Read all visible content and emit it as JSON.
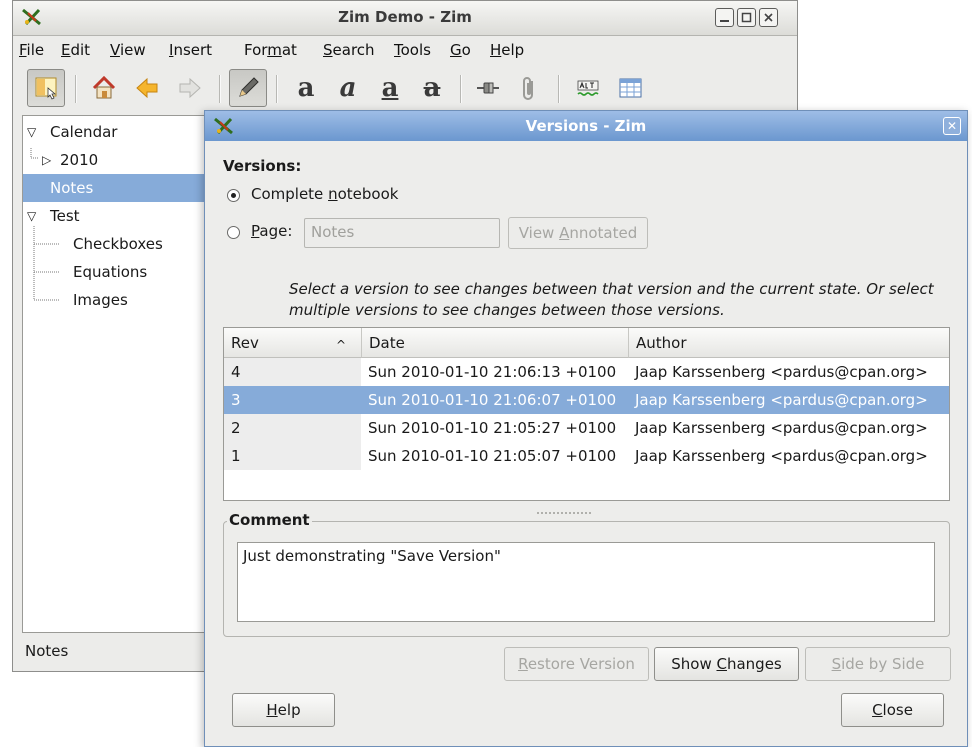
{
  "main_window": {
    "title": "Zim Demo - Zim",
    "menu": [
      {
        "name": "menu-file",
        "pre": "",
        "key": "F",
        "post": "ile"
      },
      {
        "name": "menu-edit",
        "pre": "",
        "key": "E",
        "post": "dit"
      },
      {
        "name": "menu-view",
        "pre": "",
        "key": "V",
        "post": "iew"
      },
      {
        "name": "menu-insert",
        "pre": "",
        "key": "I",
        "post": "nsert"
      },
      {
        "name": "menu-format",
        "pre": "For",
        "key": "m",
        "post": "at"
      },
      {
        "name": "menu-search",
        "pre": "",
        "key": "S",
        "post": "earch"
      },
      {
        "name": "menu-tools",
        "pre": "",
        "key": "T",
        "post": "ools"
      },
      {
        "name": "menu-go",
        "pre": "",
        "key": "G",
        "post": "o"
      },
      {
        "name": "menu-help",
        "pre": "",
        "key": "H",
        "post": "elp"
      }
    ],
    "toolbar_glyphs": {
      "strong": "a",
      "emphasis": "a",
      "mark": "a",
      "strike": "a"
    },
    "index": [
      {
        "label": "Calendar",
        "expander": "open",
        "depth": 0
      },
      {
        "label": "2010",
        "expander": "closed",
        "depth": 1
      },
      {
        "label": "Notes",
        "expander": "none",
        "depth": 0,
        "selected": true
      },
      {
        "label": "Test",
        "expander": "open",
        "depth": 0
      },
      {
        "label": "Checkboxes",
        "expander": "none",
        "depth": 1
      },
      {
        "label": "Equations",
        "expander": "none",
        "depth": 1
      },
      {
        "label": "Images",
        "expander": "none",
        "depth": 1
      }
    ],
    "status_text": "Notes"
  },
  "dialog": {
    "title": "Versions - Zim",
    "versions_heading": "Versions:",
    "complete_notebook": {
      "pre": "Complete ",
      "key": "n",
      "post": "otebook",
      "checked": true
    },
    "page_option": {
      "pre": "",
      "key": "P",
      "post": "age:",
      "checked": false
    },
    "page_entry_value": "Notes",
    "view_annotated": {
      "pre": "View ",
      "key": "A",
      "post": "nnotated"
    },
    "instructions": "Select a version to see changes between that version and the current state. Or select multiple versions to see changes between those versions.",
    "table": {
      "columns": [
        "Rev",
        "Date",
        "Author"
      ],
      "sort_indicator": "^",
      "rows": [
        {
          "rev": "4",
          "date": "Sun 2010-01-10 21:06:13 +0100",
          "author": "Jaap Karssenberg <pardus@cpan.org>",
          "selected": false
        },
        {
          "rev": "3",
          "date": "Sun 2010-01-10 21:06:07 +0100",
          "author": "Jaap Karssenberg <pardus@cpan.org>",
          "selected": true
        },
        {
          "rev": "2",
          "date": "Sun 2010-01-10 21:05:27 +0100",
          "author": "Jaap Karssenberg <pardus@cpan.org>",
          "selected": false
        },
        {
          "rev": "1",
          "date": "Sun 2010-01-10 21:05:07 +0100",
          "author": "Jaap Karssenberg <pardus@cpan.org>",
          "selected": false
        }
      ]
    },
    "comment_heading": "Comment",
    "comment_text": "Just demonstrating \"Save Version\"",
    "buttons": {
      "restore": {
        "pre": "",
        "key": "R",
        "post": "estore Version"
      },
      "show_changes": {
        "pre": "Show ",
        "key": "C",
        "post": "hanges"
      },
      "side_by_side": {
        "pre": "",
        "key": "S",
        "post": "ide by Side"
      },
      "help": {
        "pre": "",
        "key": "H",
        "post": "elp"
      },
      "close": {
        "pre": "",
        "key": "C",
        "post": "lose"
      }
    }
  },
  "colors": {
    "selection": "#86abd9",
    "dialog_title_bg": "#7aa2d6",
    "window_bg": "#ececea"
  }
}
